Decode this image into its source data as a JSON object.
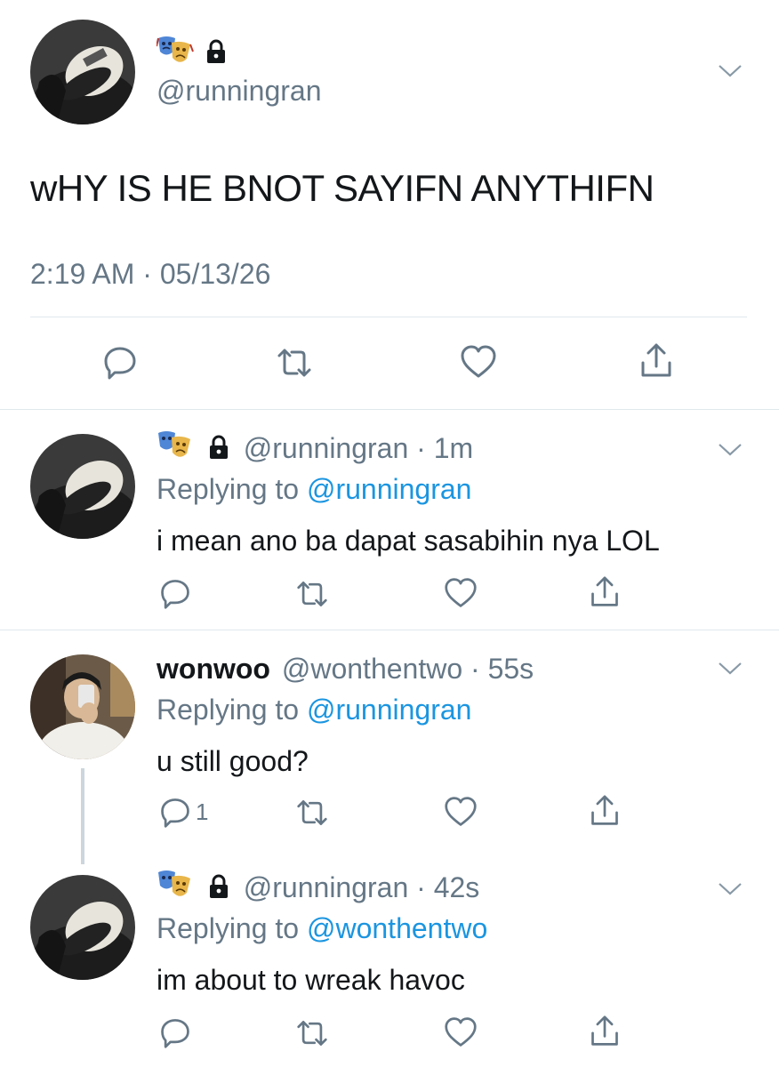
{
  "main_tweet": {
    "handle": "@runningran",
    "text": "wHY IS HE BNOT SAYIFN ANYTHIFN",
    "time": "2:19 AM",
    "date": "05/13/26",
    "time_sep": "·"
  },
  "replies": [
    {
      "display_name": "",
      "handle": "@runningran",
      "age": "1m",
      "replying_label": "Replying to",
      "replying_to": "@runningran",
      "text": "i mean ano ba dapat sasabihin nya LOL",
      "reply_count": ""
    },
    {
      "display_name": "wonwoo",
      "handle": "@wonthentwo",
      "age": "55s",
      "replying_label": "Replying to",
      "replying_to": "@runningran",
      "text": "u still good?",
      "reply_count": "1"
    },
    {
      "display_name": "",
      "handle": "@runningran",
      "age": "42s",
      "replying_label": "Replying to",
      "replying_to": "@wonthentwo",
      "text": "im about to wreak havoc",
      "reply_count": ""
    }
  ],
  "sep": "·",
  "colors": {
    "text": "#14171a",
    "muted": "#657786",
    "link": "#1b95e0",
    "divider": "#e1e8ed",
    "icon": "#657786"
  },
  "icons": [
    "performing-arts-emoji",
    "lock-icon",
    "chevron-down-icon",
    "reply-icon",
    "retweet-icon",
    "like-icon",
    "share-icon"
  ]
}
